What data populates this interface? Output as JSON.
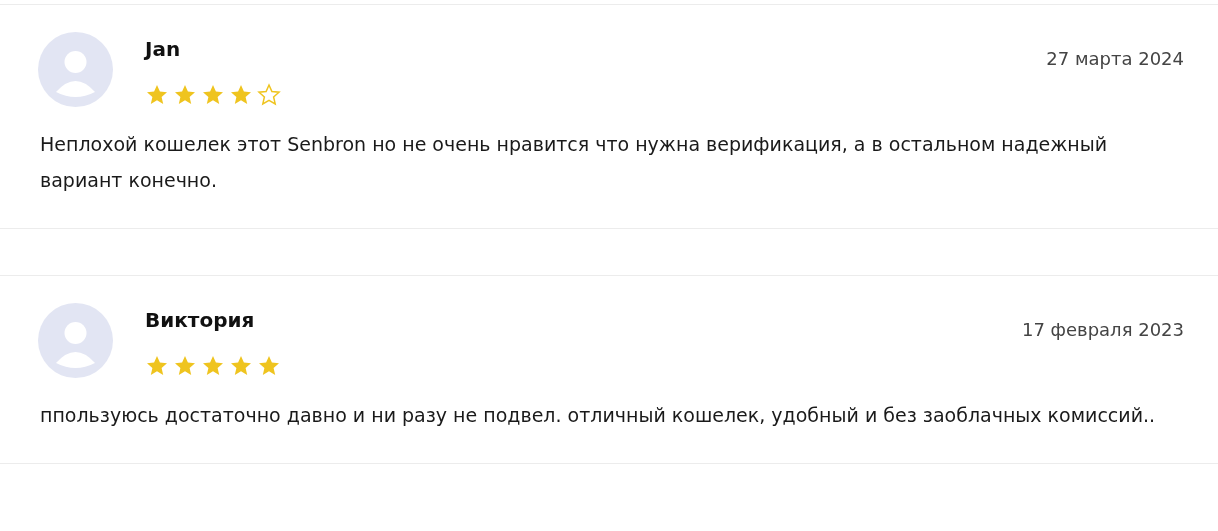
{
  "reviews": [
    {
      "author": "Jan",
      "date": "27 марта 2024",
      "stars": 4,
      "text": "Неплохой кошелек этот Senbron но не очень нравится что нужна верификация, а в остальном надежный вариант конечно."
    },
    {
      "author": "Виктория",
      "date": "17 февраля 2023",
      "stars": 5,
      "text": "ппользуюсь достаточно давно и ни разу не подвел. отличный кошелек, удобный и без заоблачных комиссий.."
    }
  ]
}
